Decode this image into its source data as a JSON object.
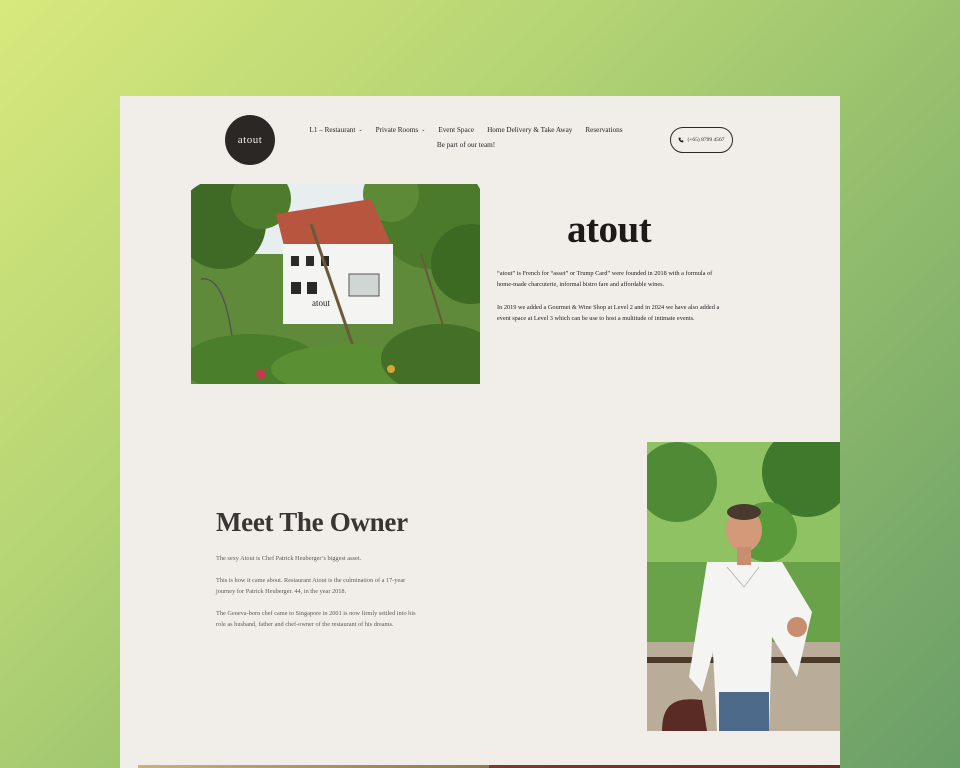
{
  "header": {
    "logo_text": "atout",
    "nav": {
      "row1": [
        {
          "label": "L1 – Restaurant",
          "dropdown": true
        },
        {
          "label": "Private Rooms",
          "dropdown": true
        },
        {
          "label": "Event Space",
          "dropdown": false
        },
        {
          "label": "Home Delivery & Take Away",
          "dropdown": false
        },
        {
          "label": "Reservations",
          "dropdown": false
        }
      ],
      "row2": [
        {
          "label": "Be part of our team!",
          "dropdown": false
        }
      ]
    },
    "phone": "(+65) 8799 4567"
  },
  "intro": {
    "title": "atout",
    "p1": "“atout” is French for “asset” or Trump Card” were founded in 2018 with a formula of home-made charcuterie, informal bistro fare and affordable wines.",
    "p2": "In 2019 we added a Gourmet & Wine Shop at Level 2 and in 2024 we have also added a event space at Level 3 which can be use to host a multitude of intimate events.",
    "building_sign": "atout"
  },
  "owner": {
    "title": "Meet The Owner",
    "p1": "The sexy Atout is Chef Patrick Heuberger’s biggest asset.",
    "p2": "This is how it came about. Restaurant Atout is the culmination of a 17-year journey for Patrick Heuberger. 44, in the year 2018.",
    "p3": "The Geneva-born chef came to Singapore in 2001 is now firmly settled into his role as husband, father and chef-owner of the restaurant of his dreams."
  },
  "colors": {
    "page_bg": "#f1eee9",
    "logo_bg": "#2a2725",
    "text_dark": "#1d1b19",
    "text_muted": "#5e5955"
  },
  "icons": {
    "phone": "phone-icon",
    "chevron": "chevron-down-icon"
  }
}
